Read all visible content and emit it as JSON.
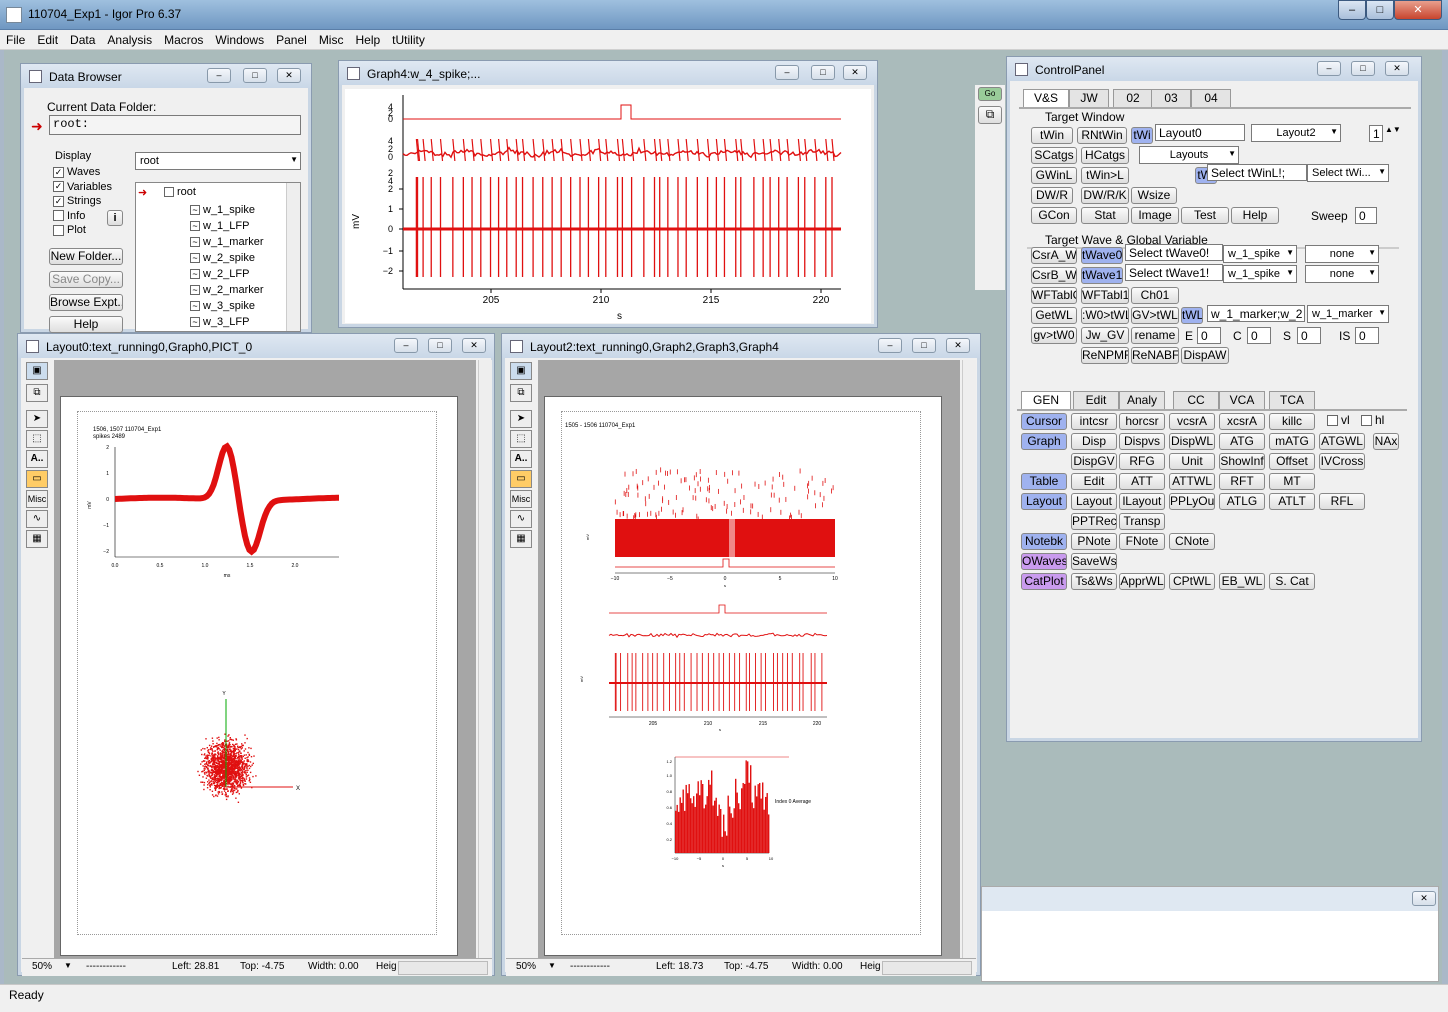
{
  "app": {
    "title": "110704_Exp1 - Igor Pro 6.37",
    "status": "Ready"
  },
  "menu": [
    "File",
    "Edit",
    "Data",
    "Analysis",
    "Macros",
    "Windows",
    "Panel",
    "Misc",
    "Help",
    "tUtility"
  ],
  "data_browser": {
    "title": "Data Browser",
    "current_folder_label": "Current Data Folder:",
    "current_folder": "root:",
    "display_label": "Display",
    "folder_select": "root",
    "checks": [
      {
        "label": "Waves",
        "checked": true
      },
      {
        "label": "Variables",
        "checked": true
      },
      {
        "label": "Strings",
        "checked": true
      },
      {
        "label": "Info",
        "checked": false
      },
      {
        "label": "Plot",
        "checked": false
      }
    ],
    "buttons": [
      "New Folder...",
      "Save Copy...",
      "Browse Expt...",
      "Help"
    ],
    "tree_root": "root",
    "tree_items": [
      "w_1_spike",
      "w_1_LFP",
      "w_1_marker",
      "w_2_spike",
      "w_2_LFP",
      "w_2_marker",
      "w_3_spike",
      "w_3_LFP"
    ]
  },
  "graph4": {
    "title": "Graph4:w_4_spike;...",
    "y_label": "mV",
    "x_label": "s",
    "x_ticks": [
      "205",
      "210",
      "215",
      "220"
    ],
    "y_ticks": [
      "2",
      "1",
      "0",
      "−1",
      "−2"
    ],
    "top_ticks": [
      "4",
      "2",
      "0",
      "4",
      "2",
      "0",
      "2",
      "4"
    ]
  },
  "layout0": {
    "title": "Layout0:text_running0,Graph0,PICT_0",
    "header": "1506, 1507 110704_Exp1",
    "subheader": "spikes 2489",
    "plot_xlabel": "ms",
    "plot_ylabel": "mV",
    "x_ticks": [
      "0.0",
      "0.5",
      "1.0",
      "1.5",
      "2.0"
    ],
    "y_ticks": [
      "2",
      "1",
      "0",
      "−1",
      "−2"
    ],
    "scatter_x": "X",
    "scatter_y": "Y",
    "status": {
      "zoom": "50%",
      "sep": "------------",
      "left": "Left: 28.81",
      "top": "Top: -4.75",
      "width": "Width: 0.00",
      "height": "Heig"
    }
  },
  "layout2": {
    "title": "Layout2:text_running0,Graph2,Graph3,Graph4",
    "header": "1505 - 1506 110704_Exp1",
    "g1_x_ticks": [
      "−10",
      "−5",
      "0",
      "5",
      "10"
    ],
    "g1_xlabel": "s",
    "g1_ylabel": "mV",
    "g2_x_ticks": [
      "205",
      "210",
      "215",
      "220"
    ],
    "g2_xlabel": "s",
    "g2_ylabel": "mV",
    "g3_title": "Index 0 Average",
    "g3_x_ticks": [
      "−10",
      "−5",
      "0",
      "5",
      "10"
    ],
    "g3_y_ticks": [
      "1.2",
      "1.0",
      "0.8",
      "0.6",
      "0.4",
      "0.2"
    ],
    "g3_xlabel": "s",
    "status": {
      "zoom": "50%",
      "sep": "------------",
      "left": "Left: 18.73",
      "top": "Top: -4.75",
      "width": "Width: 0.00",
      "height": "Heig"
    }
  },
  "control": {
    "title": "ControlPanel",
    "tabs": [
      "V&S",
      "JW",
      "02",
      "03",
      "04"
    ],
    "target_window": "Target Window",
    "r1": [
      "tWin",
      "RNtWin",
      "tWi"
    ],
    "r1_field": "Layout0",
    "r1_drop": "Layout2",
    "r1_num": "1",
    "r2": [
      "SCatgs",
      "HCatgs"
    ],
    "r2_drop": "Layouts",
    "r3": [
      "GWinL",
      "tWin>L",
      "tWi"
    ],
    "r3_field": "Select tWinL!;",
    "r3_drop": "Select tWi...",
    "r4": [
      "DW/R",
      "DW/R/K",
      "Wsize"
    ],
    "r5": [
      "GCon",
      "Stat",
      "Image",
      "Test",
      "Help"
    ],
    "sweep_label": "Sweep",
    "sweep": "0",
    "target_wave": "Target Wave & Global Variable",
    "w1": [
      "CsrA_W",
      "tWave0"
    ],
    "w1_field": "Select tWave0!",
    "w1_drop": "w_1_spike",
    "w1_none": "none",
    "w2": [
      "CsrB_W",
      "tWave1"
    ],
    "w2_field": "Select tWave1!",
    "w2_drop": "w_1_spike",
    "w2_none": "none",
    "w3": [
      "WFTablO",
      "WFTabl1",
      "Ch01"
    ],
    "w4": [
      "GetWL",
      ":W0>tWL",
      "GV>tWL",
      "tWL"
    ],
    "w4_field": "w_1_marker;w_2",
    "w4_drop": "w_1_marker",
    "w5": [
      "gv>tW0",
      "Jw_GV",
      "rename"
    ],
    "e_label": "E",
    "e_val": "0",
    "c_label": "C",
    "c_val": "0",
    "s_label": "S",
    "s_val": "0",
    "is_label": "IS",
    "is_val": "0",
    "w6": [
      "ReNPMF",
      "ReNABF",
      "DispAW"
    ],
    "gen_tabs": [
      "GEN",
      "Edit",
      "Analy",
      "CC",
      "VCA",
      "TCA"
    ],
    "gen_rows": [
      [
        "Cursor",
        "intcsr",
        "horcsr",
        "vcsrA",
        "xcsrA",
        "killc"
      ],
      [
        "Graph",
        "Disp",
        "Dispvs",
        "DispWL",
        "ATG",
        "mATG",
        "ATGWL",
        "NAx"
      ],
      [
        "",
        "DispGV",
        "RFG",
        "Unit",
        "ShowInf",
        "Offset",
        "IVCross"
      ],
      [
        "Table",
        "Edit",
        "ATT",
        "ATTWL",
        "RFT",
        "MT"
      ],
      [
        "Layout",
        "Layout",
        "lLayout",
        "PPLyOut",
        "ATLG",
        "ATLT",
        "RFL"
      ],
      [
        "",
        "PPTRec",
        "Transp"
      ],
      [
        "Notebk",
        "PNote",
        "FNote",
        "CNote"
      ],
      [
        "OWaves",
        "SaveWs"
      ],
      [
        "CatPlot",
        "Ts&Ws",
        "ApprWL",
        "CPtWL",
        "EB_WL",
        "S. Cat"
      ]
    ],
    "vl": "vl",
    "hl": "hl"
  },
  "small_buttons": [
    "Go",
    ""
  ]
}
